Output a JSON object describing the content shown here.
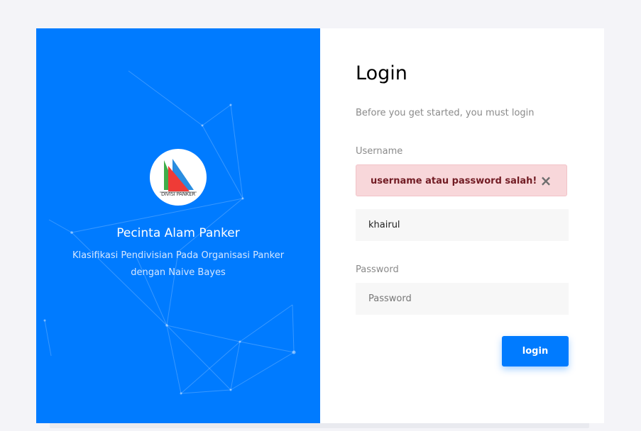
{
  "colors": {
    "accent": "#007bff",
    "alert_bg": "#f8d7da",
    "alert_text": "#721c24"
  },
  "brand": {
    "logo_text": "DIVISI PANKER",
    "org_name": "Pecinta Alam Panker",
    "org_description": "Klasifikasi Pendivisian Pada Organisasi Panker dengan Naive Bayes"
  },
  "login": {
    "title": "Login",
    "subtitle": "Before you get started, you must login",
    "username_label": "Username",
    "alert_message": "username atau password salah!",
    "alert_close_icon": "×",
    "username_value": "khairul",
    "password_label": "Password",
    "password_placeholder": "Password",
    "submit_label": "login"
  }
}
